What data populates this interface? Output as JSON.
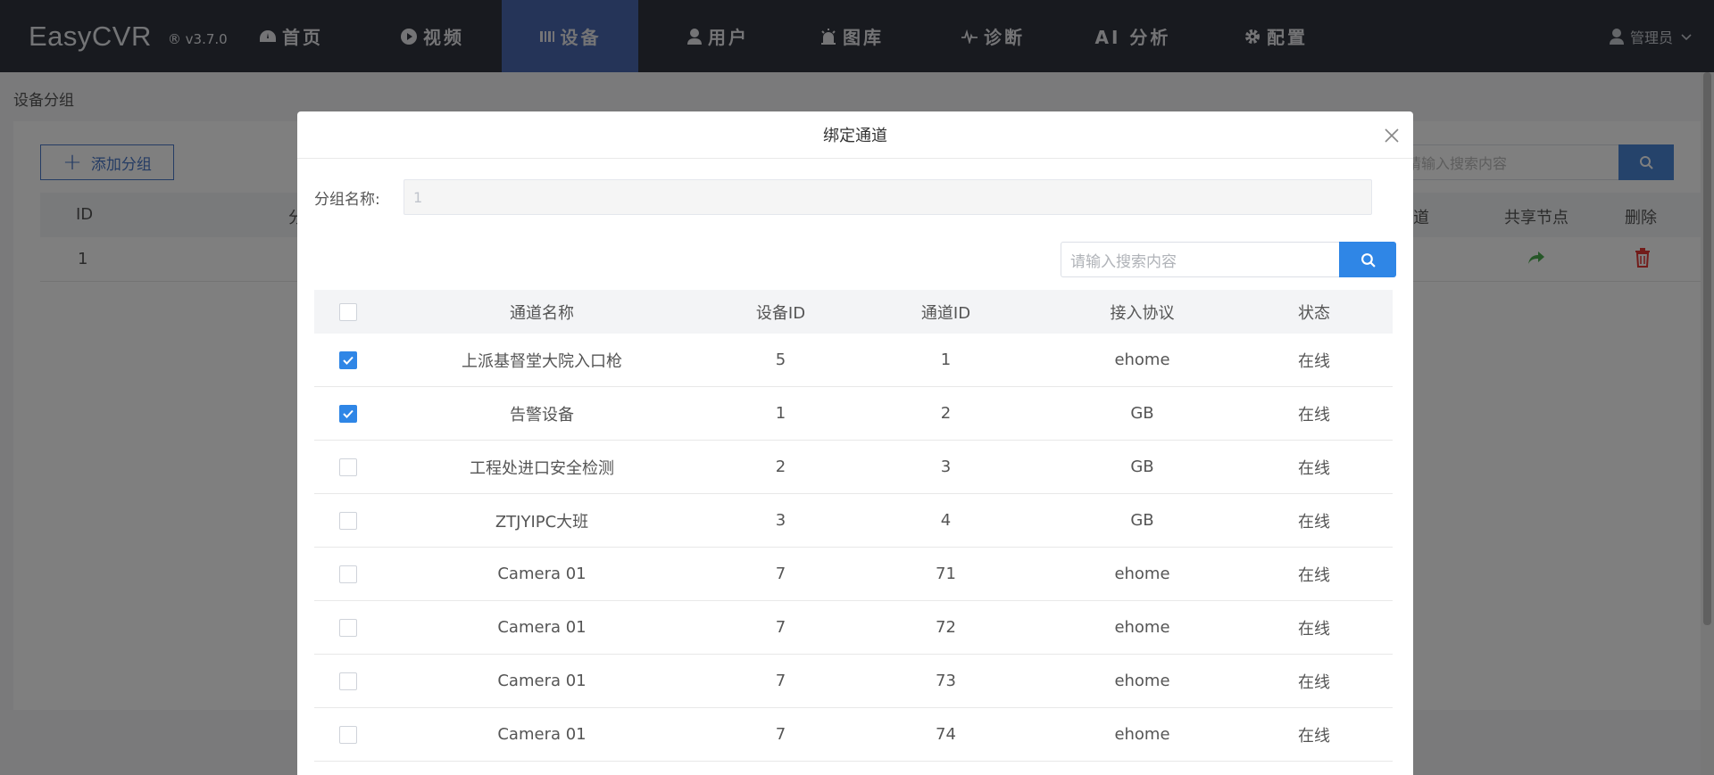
{
  "app": {
    "name": "EasyCVR",
    "version": "® v3.7.0"
  },
  "nav": [
    {
      "label": "首页",
      "icon": "dashboard-icon"
    },
    {
      "label": "视频",
      "icon": "play-icon"
    },
    {
      "label": "设备",
      "icon": "device-icon",
      "active": true
    },
    {
      "label": "用户",
      "icon": "user-icon"
    },
    {
      "label": "图库",
      "icon": "alarm-icon"
    },
    {
      "label": "诊断",
      "icon": "pulse-icon"
    },
    {
      "label": "AI 分析",
      "icon": ""
    },
    {
      "label": "配置",
      "icon": "gear-icon"
    }
  ],
  "user": {
    "label": "管理员",
    "icon": "user-icon"
  },
  "page": {
    "breadcrumb": "设备分组",
    "add_label": "添加分组",
    "search_placeholder": "请输入搜索内容",
    "columns": {
      "id": "ID",
      "group": "分组",
      "channels": "通道",
      "share": "共享节点",
      "delete": "删除"
    },
    "rows": [
      {
        "id": "1"
      }
    ]
  },
  "modal": {
    "title": "绑定通道",
    "group_label": "分组名称:",
    "group_value": "1",
    "search_placeholder": "请输入搜索内容",
    "columns": {
      "name": "通道名称",
      "device_id": "设备ID",
      "channel_id": "通道ID",
      "protocol": "接入协议",
      "status": "状态"
    },
    "rows": [
      {
        "checked": true,
        "name": "上派基督堂大院入口枪",
        "device_id": "5",
        "channel_id": "1",
        "protocol": "ehome",
        "status": "在线"
      },
      {
        "checked": true,
        "name": "告警设备",
        "device_id": "1",
        "channel_id": "2",
        "protocol": "GB",
        "status": "在线"
      },
      {
        "checked": false,
        "name": "工程处进口安全检测",
        "device_id": "2",
        "channel_id": "3",
        "protocol": "GB",
        "status": "在线"
      },
      {
        "checked": false,
        "name": "ZTJYIPC大班",
        "device_id": "3",
        "channel_id": "4",
        "protocol": "GB",
        "status": "在线"
      },
      {
        "checked": false,
        "name": "Camera 01",
        "device_id": "7",
        "channel_id": "71",
        "protocol": "ehome",
        "status": "在线"
      },
      {
        "checked": false,
        "name": "Camera 01",
        "device_id": "7",
        "channel_id": "72",
        "protocol": "ehome",
        "status": "在线"
      },
      {
        "checked": false,
        "name": "Camera 01",
        "device_id": "7",
        "channel_id": "73",
        "protocol": "ehome",
        "status": "在线"
      },
      {
        "checked": false,
        "name": "Camera 01",
        "device_id": "7",
        "channel_id": "74",
        "protocol": "ehome",
        "status": "在线"
      }
    ]
  },
  "colors": {
    "nav_bg": "#30343f",
    "nav_active": "#4a68b0",
    "primary": "#2f86e6",
    "share_green": "#4caf50",
    "delete_red": "#e53935"
  }
}
